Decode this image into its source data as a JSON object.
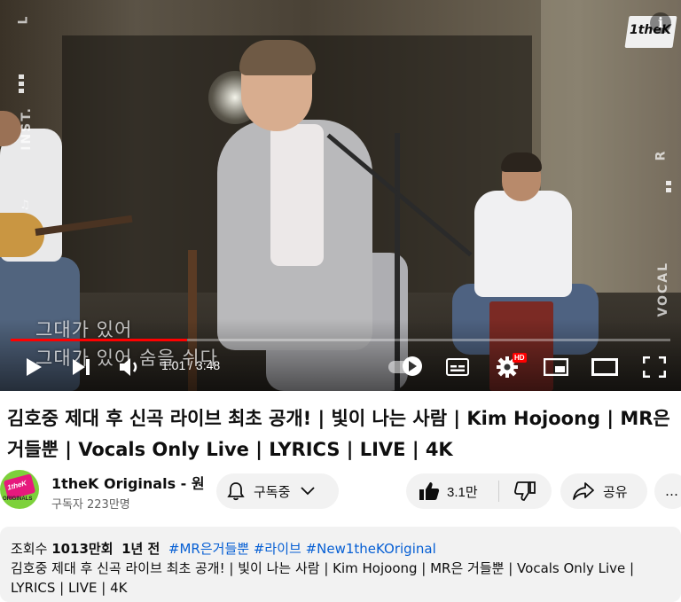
{
  "player": {
    "lyrics": [
      "그대가 있어",
      "그대가 있어 숨을 쉬다"
    ],
    "side_left_label": "INST.",
    "side_left_mark": "L",
    "side_right_label": "VOCAL",
    "side_right_mark": "R",
    "channel_logo": "1theK",
    "info_icon": "info-icon",
    "time_display": "1:01 / 3:48",
    "progress_fraction": 0.267,
    "accent_color": "#ff0000",
    "hd_badge": "HD",
    "controls": {
      "play": "play-icon",
      "next": "next-icon",
      "volume": "volume-icon",
      "autoplay": "autoplay-toggle",
      "subtitles": "subtitles-icon",
      "settings": "gear-icon",
      "miniplayer": "miniplayer-icon",
      "theater": "theater-icon",
      "fullscreen": "fullscreen-icon"
    }
  },
  "video": {
    "title": "김호중 제대 후 신곡 라이브 최초 공개! | 빛이 나는 사람 | Kim Hojoong | MR은 거들뿐 | Vocals Only Live | LYRICS | LIVE | 4K"
  },
  "channel": {
    "avatar_top": "1theK",
    "avatar_bottom": "ORIGINALS",
    "name": "1theK Originals - 원",
    "subscribers": "구독자 223만명"
  },
  "actions": {
    "subscribe_label": "구독중",
    "like_count": "3.1만",
    "share_label": "공유",
    "more_label": "…"
  },
  "description": {
    "views_label": "조회수",
    "views_value": "1013만회",
    "age": "1년 전",
    "tags": [
      "#MR은거들뿐",
      "#라이브",
      "#New1theKOriginal"
    ],
    "text": "김호중 제대 후 신곡 라이브 최초 공개! | 빛이 나는 사람 | Kim Hojoong | MR은 거들뿐 | Vocals Only Live | LYRICS | LIVE | 4K"
  }
}
